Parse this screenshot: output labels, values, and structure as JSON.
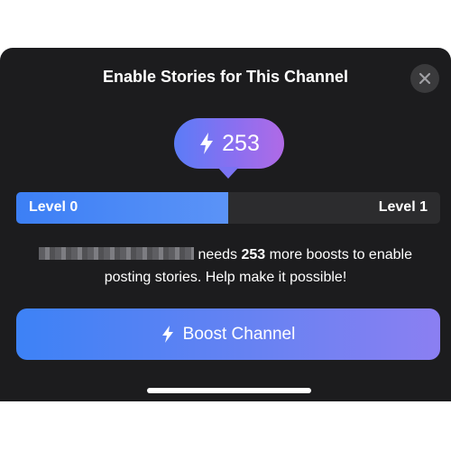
{
  "dialog": {
    "title": "Enable Stories for This Channel",
    "close_icon": "close-icon"
  },
  "boost_bubble": {
    "icon": "lightning-bolt-icon",
    "count": "253",
    "colors": [
      "#5b7cf7",
      "#b06ae6"
    ]
  },
  "level_progress": {
    "current_label": "Level 0",
    "next_label": "Level 1",
    "progress_fraction": 0.5,
    "fill_color": "#3c7ff5"
  },
  "message": {
    "needs": " needs ",
    "boost_count": "253",
    "rest": " more boosts to enable posting stories. Help make it possible!"
  },
  "primary_button": {
    "icon": "lightning-bolt-icon",
    "label": "Boost Channel"
  }
}
